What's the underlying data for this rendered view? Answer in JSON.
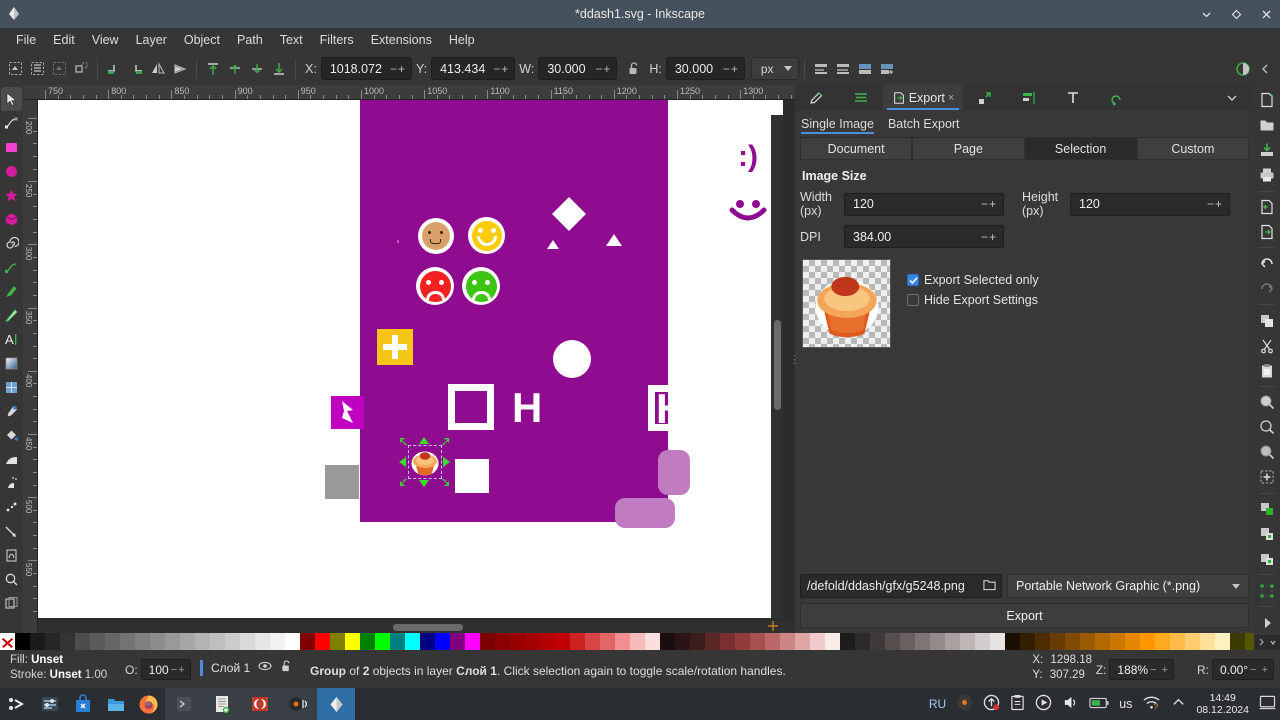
{
  "window": {
    "title": "*ddash1.svg - Inkscape",
    "logo_icon": "inkscape-logo-icon",
    "minimize_icon": "chevron-down-icon",
    "maximize_icon": "diamond-icon",
    "close_icon": "close-icon"
  },
  "menubar": {
    "items": [
      {
        "label": "File"
      },
      {
        "label": "Edit"
      },
      {
        "label": "View"
      },
      {
        "label": "Layer"
      },
      {
        "label": "Object"
      },
      {
        "label": "Path"
      },
      {
        "label": "Text"
      },
      {
        "label": "Filters"
      },
      {
        "label": "Extensions"
      },
      {
        "label": "Help"
      }
    ]
  },
  "toolbar": {
    "x_label": "X:",
    "x_value": "1018.072",
    "y_label": "Y:",
    "y_value": "413.434",
    "w_label": "W:",
    "w_value": "30.000",
    "h_label": "H:",
    "h_value": "30.000",
    "unit": "px",
    "stepper": "−+",
    "lock_icon": "lock-open-icon"
  },
  "rulers": {
    "h_start": 750,
    "h_end": 1300,
    "h_step": 50,
    "h_labels": [
      "750",
      "800",
      "850",
      "900",
      "950",
      "1000",
      "1050",
      "1100",
      "1150",
      "1200",
      "1250",
      "1300"
    ],
    "v_labels": [
      "200",
      "250",
      "300",
      "350",
      "400",
      "450",
      "500",
      "550"
    ]
  },
  "canvas": {
    "page_color": "#8f0b8f",
    "background": "#ffffff",
    "selection_hint": "scale-handles",
    "objects": [
      {
        "name": "emoji-neutral-face",
        "color": "#d9a06a"
      },
      {
        "name": "emoji-smile-face",
        "color": "#ffcc00"
      },
      {
        "name": "emoji-sad-red-face",
        "color": "#f22222"
      },
      {
        "name": "emoji-sad-green-face",
        "color": "#3ec413"
      },
      {
        "name": "yellow-plus-square",
        "color": "#f5c518"
      },
      {
        "name": "white-diamond",
        "color": "#ffffff"
      },
      {
        "name": "white-circle",
        "color": "#ffffff"
      },
      {
        "name": "white-square-outline",
        "color": "#ffffff"
      },
      {
        "name": "letter-h-glyph",
        "color": "#ffffff"
      },
      {
        "name": "white-square-filled",
        "color": "#ffffff"
      },
      {
        "name": "magenta-arrow-square",
        "color": "#c000c0"
      },
      {
        "name": "gray-square",
        "color": "#999999"
      },
      {
        "name": "cupcake-selected",
        "color": "#e8762c"
      },
      {
        "name": "purple-sad-emoticon",
        "color": "#8f0b8f"
      },
      {
        "name": "purple-smile-emoticon",
        "color": "#8f0b8f"
      },
      {
        "name": "purple-face-emoticon",
        "color": "#8f0b8f"
      }
    ]
  },
  "dock": {
    "tabs": [
      {
        "name": "xml-editor",
        "icon": "pencil-square-icon",
        "active": false
      },
      {
        "name": "layers",
        "icon": "layers-icon",
        "active": false
      },
      {
        "name": "export",
        "icon": "export-icon",
        "label": "Export",
        "close": "×",
        "active": true
      },
      {
        "name": "objects",
        "icon": "objects-icon",
        "active": false
      },
      {
        "name": "align",
        "icon": "align-icon",
        "active": false
      },
      {
        "name": "text",
        "icon": "text-icon",
        "active": false
      },
      {
        "name": "undo-history",
        "icon": "undo-history-icon",
        "active": false
      }
    ],
    "overflow_icon": "chevron-down-icon",
    "subtabs": [
      {
        "label": "Single Image",
        "active": true
      },
      {
        "label": "Batch Export",
        "active": false
      }
    ],
    "area_segments": [
      {
        "label": "Document",
        "active": false
      },
      {
        "label": "Page",
        "active": false
      },
      {
        "label": "Selection",
        "active": true
      },
      {
        "label": "Custom",
        "active": false
      }
    ],
    "image_size_title": "Image Size",
    "width_label": "Width (px)",
    "width_value": "120",
    "height_label": "Height (px)",
    "height_value": "120",
    "dpi_label": "DPI",
    "dpi_value": "384.00",
    "stepper": "−+",
    "preview_name": "cupcake-preview",
    "checkboxes": [
      {
        "label": "Export Selected only",
        "checked": true
      },
      {
        "label": "Hide Export Settings",
        "checked": false
      }
    ],
    "filename": "/defold/ddash/gfx/g5248.png",
    "folder_icon": "folder-open-icon",
    "filetype": "Portable Network Graphic (*.png)",
    "export_button": "Export"
  },
  "statusbar": {
    "fill_label": "Fill:",
    "fill_value": "Unset",
    "stroke_label": "Stroke:",
    "stroke_value": "Unset",
    "stroke_width": "1.00",
    "opacity_label": "O:",
    "opacity_value": "100",
    "layer_name": "Слой 1",
    "eye_icon": "eye-icon",
    "lock_icon": "lock-open-icon",
    "message_parts": {
      "a": "Group",
      "b": " of ",
      "c": "2",
      "d": " objects in layer ",
      "e": "Слой 1",
      "f": ". Click selection again to toggle scale/rotation handles."
    },
    "x_label": "X:",
    "x_value": "1298.18",
    "y_label": "Y:",
    "y_value": "307.29",
    "zoom_label": "Z:",
    "zoom_value": "188%",
    "rotation_label": "R:",
    "rotation_value": "0.00°",
    "stepper": "− +"
  },
  "taskbar": {
    "launchers": [
      {
        "name": "app-menu-icon"
      },
      {
        "name": "settings-icon"
      },
      {
        "name": "software-store-icon"
      },
      {
        "name": "file-manager-icon"
      },
      {
        "name": "firefox-icon"
      }
    ],
    "windows": [
      {
        "name": "terminal-window",
        "active": false
      },
      {
        "name": "text-editor-window",
        "active": false
      },
      {
        "name": "double-commander-window",
        "active": false
      },
      {
        "name": "audio-player-window",
        "active": false
      },
      {
        "name": "inkscape-window",
        "active": true
      }
    ],
    "tray": {
      "lang_ru": "RU",
      "icons": [
        "disc-icon",
        "update-icon",
        "clipboard-icon",
        "media-play-icon",
        "volume-icon",
        "battery-icon"
      ],
      "keyboard": "us",
      "wifi_icon": "wifi-question-icon",
      "expand_icon": "chevron-up-icon",
      "time": "14:49",
      "date": "08.12.2024",
      "show-desktop-icon": "show-desktop-icon"
    }
  },
  "palette": {
    "none_label": "X",
    "colors": [
      "#000000",
      "#1a1a1a",
      "#262626",
      "#333333",
      "#4d4d4d",
      "#5a5a5a",
      "#666666",
      "#737373",
      "#808080",
      "#8c8c8c",
      "#999999",
      "#a6a6a6",
      "#b3b3b3",
      "#bfbfbf",
      "#cccccc",
      "#d9d9d9",
      "#e6e6e6",
      "#f2f2f2",
      "#ffffff",
      "#800000",
      "#ff0000",
      "#808000",
      "#ffff00",
      "#008000",
      "#00ff00",
      "#008080",
      "#00ffff",
      "#000080",
      "#0000ff",
      "#800080",
      "#ff00ff",
      "#7d0000",
      "#8b0000",
      "#990000",
      "#a50000",
      "#b30000",
      "#c00000",
      "#cc2222",
      "#d94444",
      "#e36666",
      "#ef8f8f",
      "#f7bbbb",
      "#fcdede",
      "#1a0d0d",
      "#2b1414",
      "#3d1c1c",
      "#5c2626",
      "#7a3030",
      "#933c3c",
      "#a85050",
      "#bb6868",
      "#cd8686",
      "#dea5a5",
      "#efcaca",
      "#faeaea",
      "#1c1c1c",
      "#2e2a2a",
      "#403a3a",
      "#564d4d",
      "#6b6161",
      "#807575",
      "#968b8b",
      "#aaa0a0",
      "#bfb6b6",
      "#d4cdcd",
      "#e8e3e3",
      "#1a0f00",
      "#331e00",
      "#4d2d00",
      "#663c00",
      "#804b00",
      "#995a00",
      "#b36900",
      "#cc7800",
      "#e68700",
      "#ff9600",
      "#ffa91f",
      "#ffbb47",
      "#ffcd70",
      "#ffdf99",
      "#fff0c2",
      "#3b3b00",
      "#565600",
      "#717100",
      "#8c8c00",
      "#a7a700",
      "#c2c200",
      "#dddd00",
      "#f0f000"
    ]
  }
}
